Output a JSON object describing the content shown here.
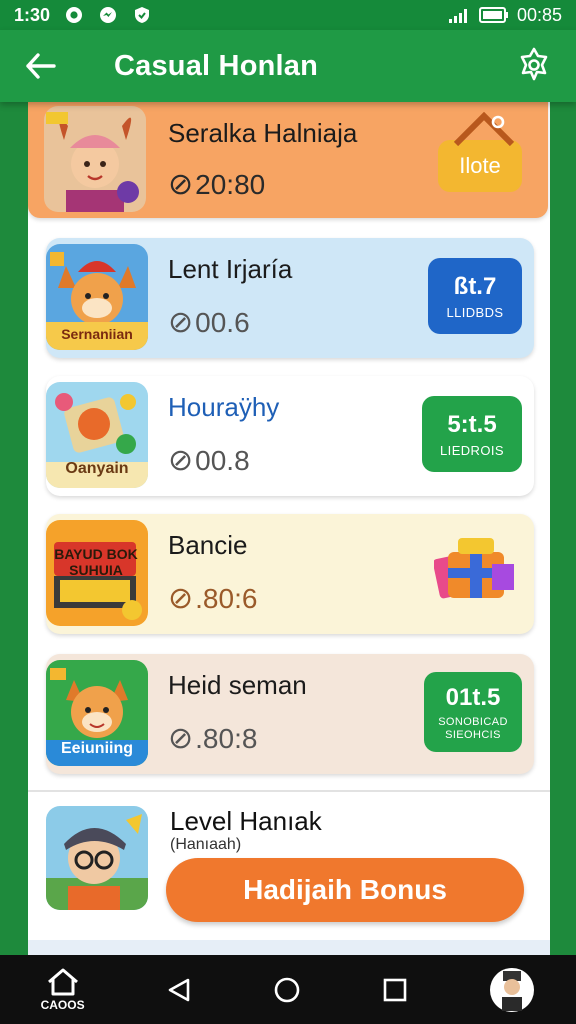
{
  "status_bar": {
    "time": "1:30",
    "battery": "00:85"
  },
  "header": {
    "title": "Casual Honlan",
    "back_icon": "arrow-left-icon",
    "settings_icon": "gear-badge-icon"
  },
  "cards": [
    {
      "title": "Seralka Halniaja",
      "value": "20:80",
      "badge_text": "Ilote",
      "colors": {
        "bg": "#f7a463",
        "badge": "#f3b730"
      }
    },
    {
      "title": "Lent Irjaría",
      "value": "00.6",
      "badge_big": "ßt.7",
      "badge_small": "LLIDBDS",
      "thumb_label": "Sernaniian",
      "colors": {
        "bg": "#cfe7f7",
        "badge": "#1f66c8"
      }
    },
    {
      "title": "Houraÿhy",
      "value": "00.8",
      "badge_big": "5:t.5",
      "badge_small": "LIEDROIS",
      "thumb_label": "Oanyain",
      "colors": {
        "bg": "#ffffff",
        "badge": "#23a34a"
      }
    },
    {
      "title": "Bancie",
      "value": ".80:6",
      "thumb_label": "BAYUD BOK SUHUIA",
      "colors": {
        "bg": "#fbf4d8",
        "value": "#9a5a2a"
      }
    },
    {
      "title": "Heid seman",
      "value": ".80:8",
      "badge_big": "01t.5",
      "badge_small_1": "SONOBICAD",
      "badge_small_2": "SIEOHCIS",
      "thumb_label": "Eeiuniing",
      "colors": {
        "bg": "#f4e6da",
        "badge": "#23a34a"
      }
    }
  ],
  "level": {
    "title": "Level Hanıak",
    "subtitle": "(Hanıaah)",
    "button": "Hadijaih Bonus"
  },
  "nav": {
    "home_label": "CAOOS"
  }
}
